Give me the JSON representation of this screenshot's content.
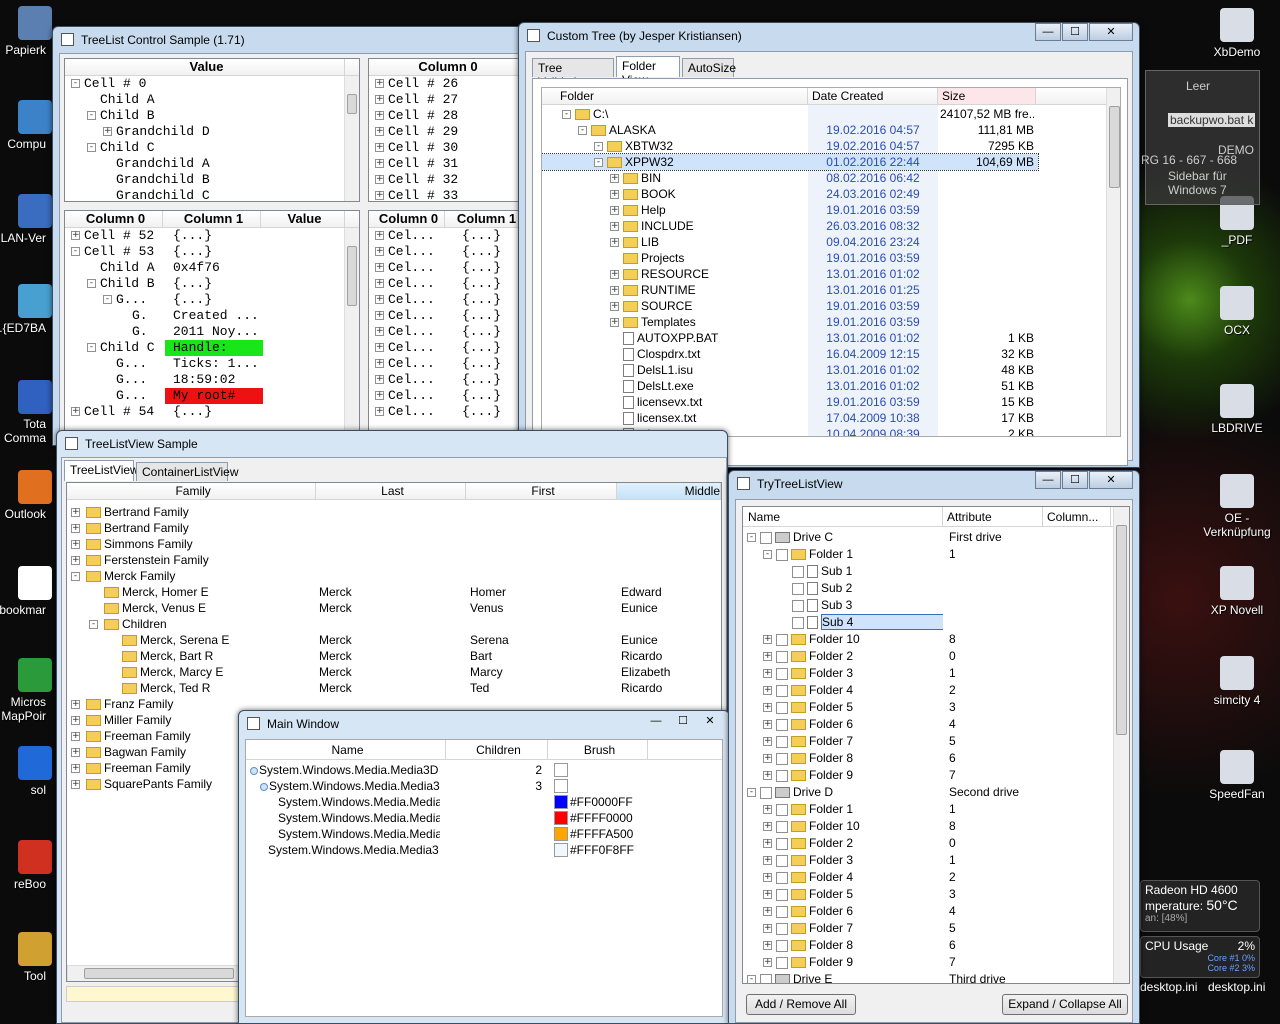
{
  "desktop": {
    "left_icons": [
      "Papierk",
      "Compu",
      "LAN-Ver",
      "..{ED7BA",
      "Tota\nComma",
      "Outlook",
      "bookmar",
      "Micros\nMapPoir",
      "sol",
      "reBoo",
      "Tool"
    ],
    "right_icons": [
      "XbDemo",
      "_PDF",
      "OCX",
      "LBDRIVE",
      "OE -\nVerknüpfung",
      "XP Novell",
      "simcity 4",
      "SpeedFan"
    ],
    "sidebar_text": [
      "Leer",
      "backupwo.bat k",
      "DEMO",
      "RG 16 - 667 - 668",
      "Sidebar für\nWindows 7"
    ],
    "gadget_gpu": {
      "title": "Radeon HD 4600",
      "temp_label": "mperature:",
      "temp": "50°C",
      "pct": "an: [48%]"
    },
    "gadget_cpu": {
      "label": "CPU Usage",
      "value": "2%",
      "core1": "Core #1",
      "core1v": "0%",
      "core2": "Core #2",
      "core2v": "3%"
    },
    "bottom_files": [
      "desktop.ini",
      "desktop.ini"
    ]
  },
  "treelist": {
    "title": "TreeList Control Sample (1.71)",
    "p1": {
      "header": "Value",
      "rows": [
        "Cell # 0",
        "Child A",
        "Child B",
        "Grandchild D",
        "Child C",
        "Grandchild A",
        "Grandchild B",
        "Grandchild C"
      ]
    },
    "p2": {
      "header": "Column 0",
      "rows": [
        "Cell # 26",
        "Cell # 27",
        "Cell # 28",
        "Cell # 29",
        "Cell # 30",
        "Cell # 31",
        "Cell # 32",
        "Cell # 33"
      ]
    },
    "p3": {
      "headers": [
        "Column 0",
        "Column 1",
        "Value"
      ],
      "rows": [
        [
          "Cell # 52",
          "{...}"
        ],
        [
          "Cell # 53",
          "{...}"
        ],
        [
          "Child A",
          "0x4f76"
        ],
        [
          "Child B",
          "{...}"
        ],
        [
          "G...",
          "{...}"
        ],
        [
          "G.",
          "Created ..."
        ],
        [
          "G.",
          "2011 Noy..."
        ],
        [
          "Child C",
          "Handle:"
        ],
        [
          "G...",
          "Ticks: 1..."
        ],
        [
          "G...",
          "18:59:02"
        ],
        [
          "G...",
          "My root#"
        ],
        [
          "Cell # 54",
          "{...}"
        ]
      ]
    },
    "p4": {
      "headers": [
        "Column 0",
        "Column 1"
      ],
      "c0": "Cel...",
      "c1": "{...}"
    },
    "green": "#19e619",
    "red": "#ee1111"
  },
  "custom": {
    "title": "Custom Tree (by Jesper Kristiansen)",
    "tabs": [
      "Tree Validation",
      "Folder View",
      "AutoSize"
    ],
    "headers": [
      "Folder",
      "Date Created",
      "Size"
    ],
    "rows": [
      {
        "n": "C:\\",
        "d": "",
        "s": "24107,52 MB fre..."
      },
      {
        "n": "ALASKA",
        "d": "19.02.2016 04:57",
        "s": "111,81 MB"
      },
      {
        "n": "XBTW32",
        "d": "19.02.2016 04:57",
        "s": "7295 KB"
      },
      {
        "n": "XPPW32",
        "d": "01.02.2016 22:44",
        "s": "104,69 MB"
      },
      {
        "n": "BIN",
        "d": "08.02.2016 06:42",
        "s": ""
      },
      {
        "n": "BOOK",
        "d": "24.03.2016 02:49",
        "s": ""
      },
      {
        "n": "Help",
        "d": "19.01.2016 03:59",
        "s": ""
      },
      {
        "n": "INCLUDE",
        "d": "26.03.2016 08:32",
        "s": ""
      },
      {
        "n": "LIB",
        "d": "09.04.2016 23:24",
        "s": ""
      },
      {
        "n": "Projects",
        "d": "19.01.2016 03:59",
        "s": ""
      },
      {
        "n": "RESOURCE",
        "d": "13.01.2016 01:02",
        "s": ""
      },
      {
        "n": "RUNTIME",
        "d": "13.01.2016 01:25",
        "s": ""
      },
      {
        "n": "SOURCE",
        "d": "19.01.2016 03:59",
        "s": ""
      },
      {
        "n": "Templates",
        "d": "19.01.2016 03:59",
        "s": ""
      },
      {
        "n": "AUTOXPP.BAT",
        "d": "13.01.2016 01:02",
        "s": "1 KB"
      },
      {
        "n": "Clospdrx.txt",
        "d": "16.04.2009 12:15",
        "s": "32 KB"
      },
      {
        "n": "DelsL1.isu",
        "d": "13.01.2016 01:02",
        "s": "48 KB"
      },
      {
        "n": "DelsLt.exe",
        "d": "13.01.2016 01:02",
        "s": "51 KB"
      },
      {
        "n": "licensevx.txt",
        "d": "19.01.2016 03:59",
        "s": "15 KB"
      },
      {
        "n": "licensex.txt",
        "d": "17.04.2009 10:38",
        "s": "17 KB"
      },
      {
        "n": "pdrx.txt",
        "d": "10.04.2009 08:39",
        "s": "2 KB"
      }
    ]
  },
  "tlv": {
    "title": "TreeListView Sample",
    "tabs": [
      "TreeListView",
      "ContainerListView"
    ],
    "headers": [
      "Family",
      "Last",
      "First",
      "Middle"
    ],
    "rows": [
      {
        "n": "Bertrand Family",
        "l": "",
        "f": "",
        "m": ""
      },
      {
        "n": "Bertrand Family",
        "l": "",
        "f": "",
        "m": ""
      },
      {
        "n": "Simmons Family",
        "l": "",
        "f": "",
        "m": ""
      },
      {
        "n": "Ferstenstein Family",
        "l": "",
        "f": "",
        "m": ""
      },
      {
        "n": "Merck Family",
        "l": "",
        "f": "",
        "m": ""
      },
      {
        "n": "Merck, Homer E",
        "l": "Merck",
        "f": "Homer",
        "m": "Edward"
      },
      {
        "n": "Merck, Venus E",
        "l": "Merck",
        "f": "Venus",
        "m": "Eunice"
      },
      {
        "n": "Children",
        "l": "",
        "f": "",
        "m": ""
      },
      {
        "n": "Merck, Serena E",
        "l": "Merck",
        "f": "Serena",
        "m": "Eunice"
      },
      {
        "n": "Merck, Bart R",
        "l": "Merck",
        "f": "Bart",
        "m": "Ricardo"
      },
      {
        "n": "Merck, Marcy E",
        "l": "Merck",
        "f": "Marcy",
        "m": "Elizabeth"
      },
      {
        "n": "Merck, Ted R",
        "l": "Merck",
        "f": "Ted",
        "m": "Ricardo"
      },
      {
        "n": "Franz Family",
        "l": "",
        "f": "",
        "m": ""
      },
      {
        "n": "Miller Family",
        "l": "",
        "f": "",
        "m": ""
      },
      {
        "n": "Freeman Family",
        "l": "",
        "f": "",
        "m": ""
      },
      {
        "n": "Bagwan Family",
        "l": "",
        "f": "",
        "m": ""
      },
      {
        "n": "Freeman Family",
        "l": "",
        "f": "",
        "m": ""
      },
      {
        "n": "SquarePants Family",
        "l": "",
        "f": "",
        "m": ""
      }
    ]
  },
  "main": {
    "title": "Main Window",
    "headers": [
      "Name",
      "Children",
      "Brush"
    ],
    "rows": [
      {
        "n": "System.Windows.Media.Media3D",
        "c": "2",
        "b": "",
        "col": "#ffffff"
      },
      {
        "n": "System.Windows.Media.Media3",
        "c": "3",
        "b": "",
        "col": "#ffffff"
      },
      {
        "n": "System.Windows.Media.Media",
        "c": "",
        "b": "#FF0000FF",
        "col": "#0000ff"
      },
      {
        "n": "System.Windows.Media.Media",
        "c": "",
        "b": "#FFFF0000",
        "col": "#ff0000"
      },
      {
        "n": "System.Windows.Media.Media",
        "c": "",
        "b": "#FFFFA500",
        "col": "#ffa500"
      },
      {
        "n": "System.Windows.Media.Media3",
        "c": "",
        "b": "#FFF0F8FF",
        "col": "#f0f8ff"
      }
    ]
  },
  "try": {
    "title": "TryTreeListView",
    "headers": [
      "Name",
      "Attribute",
      "Column..."
    ],
    "rows": [
      {
        "n": "Drive C",
        "a": "First drive"
      },
      {
        "n": "Folder 1",
        "a": "1"
      },
      {
        "n": "Sub 1",
        "a": ""
      },
      {
        "n": "Sub 2",
        "a": ""
      },
      {
        "n": "Sub 3",
        "a": ""
      },
      {
        "n": "Sub 4",
        "a": ""
      },
      {
        "n": "Folder 10",
        "a": "8"
      },
      {
        "n": "Folder 2",
        "a": "0"
      },
      {
        "n": "Folder 3",
        "a": "1"
      },
      {
        "n": "Folder 4",
        "a": "2"
      },
      {
        "n": "Folder 5",
        "a": "3"
      },
      {
        "n": "Folder 6",
        "a": "4"
      },
      {
        "n": "Folder 7",
        "a": "5"
      },
      {
        "n": "Folder 8",
        "a": "6"
      },
      {
        "n": "Folder 9",
        "a": "7"
      },
      {
        "n": "Drive D",
        "a": "Second drive"
      },
      {
        "n": "Folder 1",
        "a": "1"
      },
      {
        "n": "Folder 10",
        "a": "8"
      },
      {
        "n": "Folder 2",
        "a": "0"
      },
      {
        "n": "Folder 3",
        "a": "1"
      },
      {
        "n": "Folder 4",
        "a": "2"
      },
      {
        "n": "Folder 5",
        "a": "3"
      },
      {
        "n": "Folder 6",
        "a": "4"
      },
      {
        "n": "Folder 7",
        "a": "5"
      },
      {
        "n": "Folder 8",
        "a": "6"
      },
      {
        "n": "Folder 9",
        "a": "7"
      },
      {
        "n": "Drive E",
        "a": "Third drive"
      }
    ],
    "buttons": [
      "Add / Remove All",
      "Expand / Collapse All"
    ]
  }
}
